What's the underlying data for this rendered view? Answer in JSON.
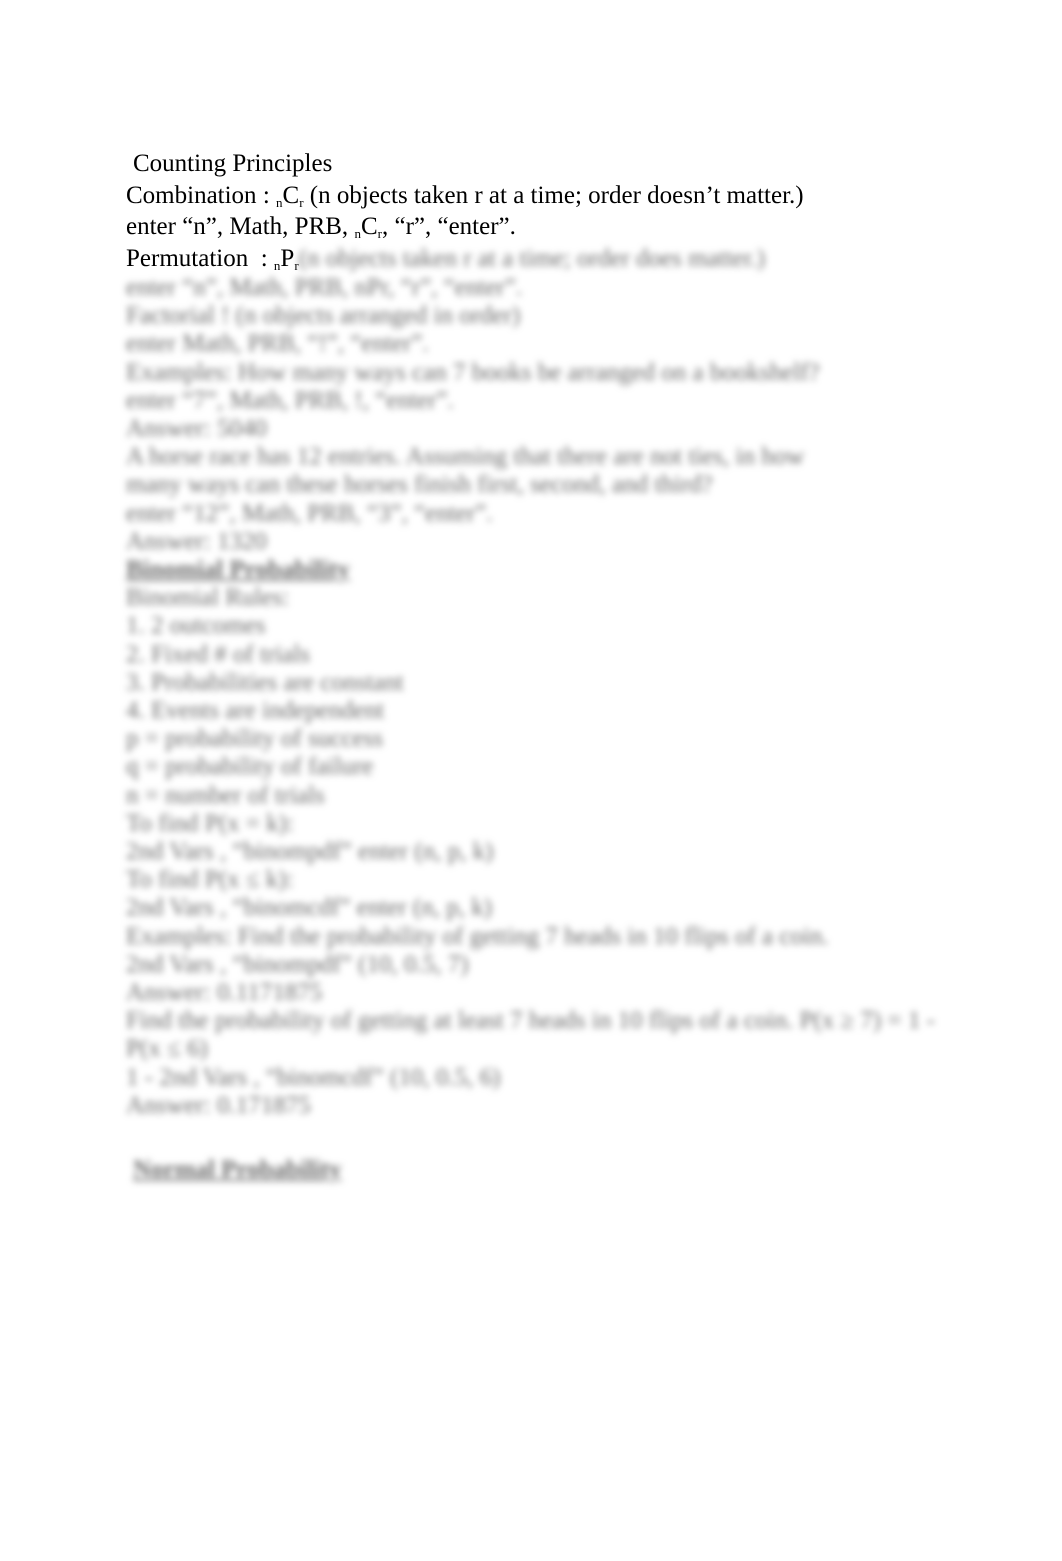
{
  "title": "Counting Principles",
  "combination": {
    "label": "Combination",
    "sep": " : ",
    "sym_pre": "n",
    "sym": "C",
    "sym_post": "r",
    "desc": " (n objects taken r at a time; order doesn’t matter.)",
    "instr_a": "enter “n”, Math, PRB, ",
    "instr_sym_pre": "n",
    "instr_sym": "C",
    "instr_sym_post": "r",
    "instr_b": ", “r”, “enter”."
  },
  "permutation": {
    "label": "Permutation",
    "sep": "  : ",
    "sym_pre": "n",
    "sym": "P",
    "sym_post": "r",
    "desc": " (n objects taken r at a time; order does matter.)"
  },
  "blurred_lines": [
    "enter “n”, Math, PRB, nPr, “r”, “enter”.",
    "Factorial   ! (n objects arranged in order)",
    "enter Math, PRB, “!”, “enter”.",
    "Examples: How many ways can 7 books be arranged on a bookshelf?",
    "enter “7”, Math, PRB, !, “enter”.",
    "Answer: 5040",
    "A horse race has 12 entries. Assuming that there are not ties, in how",
    "many ways can these horses finish first, second, and third?",
    "enter “12”, Math, PRB, “3”, “enter”.",
    "Answer: 1320"
  ],
  "binomial": {
    "heading": "Binomial Probability",
    "lines": [
      "Binomial Rules:",
      "1. 2 outcomes",
      "2. Fixed # of trials",
      "3. Probabilities are constant",
      "4. Events are independent",
      "p = probability of success",
      "q = probability of failure",
      "n = number of trials",
      "To find P(x = k):",
      "2nd Vars , “binompdf” enter (n, p, k)",
      "To find P(x ≤ k):",
      "2nd Vars , “binomcdf” enter (n, p, k)",
      "Examples: Find the probability of getting 7 heads in 10 flips of a coin.",
      "2nd Vars , “binompdf” (10, 0.5, 7)",
      "Answer: 0.1171875",
      "Find the probability of getting at least 7 heads in 10 flips of a coin. P(x ≥ 7) = 1 -",
      "P(x ≤ 6)",
      "1 - 2nd Vars , “binomcdf” (10, 0.5, 6)",
      "Answer: 0.171875"
    ]
  },
  "normal": {
    "heading": "Normal Probability"
  }
}
